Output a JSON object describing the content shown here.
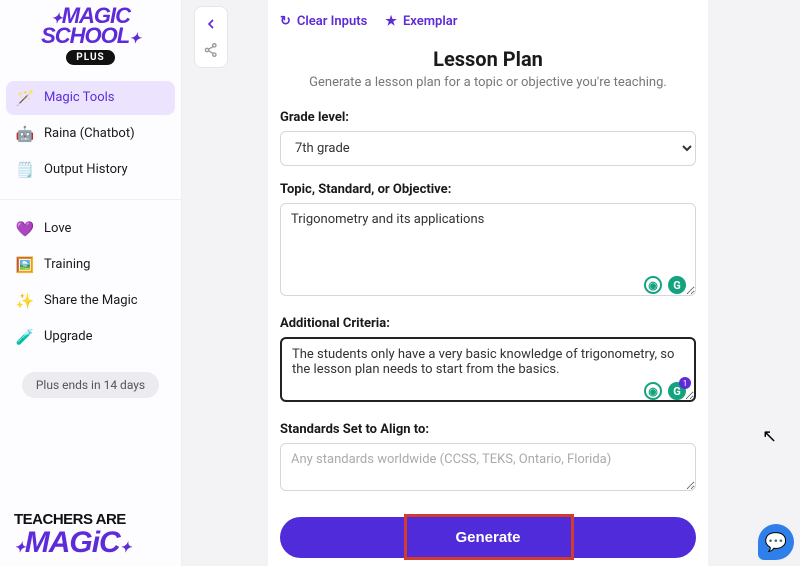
{
  "logo": {
    "line1": "MAGIC",
    "line2": "SCHOOL",
    "badge": "PLUS"
  },
  "sidebar": {
    "primary": [
      {
        "label": "Magic Tools",
        "icon": "🪄",
        "name": "nav-magic-tools",
        "active": true
      },
      {
        "label": "Raina (Chatbot)",
        "icon": "🤖",
        "name": "nav-raina",
        "active": false
      },
      {
        "label": "Output History",
        "icon": "🗒️",
        "name": "nav-output-history",
        "active": false
      }
    ],
    "secondary": [
      {
        "label": "Love",
        "icon": "💜",
        "name": "nav-love"
      },
      {
        "label": "Training",
        "icon": "🖼️",
        "name": "nav-training"
      },
      {
        "label": "Share the Magic",
        "icon": "✨",
        "name": "nav-share"
      },
      {
        "label": "Upgrade",
        "icon": "🧪",
        "name": "nav-upgrade"
      }
    ],
    "trial_text": "Plus ends in 14 days",
    "footer": {
      "line1": "TEACHERS ARE",
      "line2": "MAGiC"
    }
  },
  "top_actions": {
    "clear": "Clear Inputs",
    "exemplar": "Exemplar"
  },
  "form": {
    "title": "Lesson Plan",
    "subtitle": "Generate a lesson plan for a topic or objective you're teaching.",
    "grade_label": "Grade level:",
    "grade_value": "7th grade",
    "topic_label": "Topic, Standard, or Objective:",
    "topic_value": "Trigonometry and its applications",
    "additional_label": "Additional Criteria:",
    "additional_value": "The students only have a very basic knowledge of trigonometry, so the lesson plan needs to start from the basics.",
    "standards_label": "Standards Set to Align to:",
    "standards_placeholder": "Any standards worldwide (CCSS, TEKS, Ontario, Florida)",
    "generate_label": "Generate",
    "assistant_badge": "1"
  }
}
